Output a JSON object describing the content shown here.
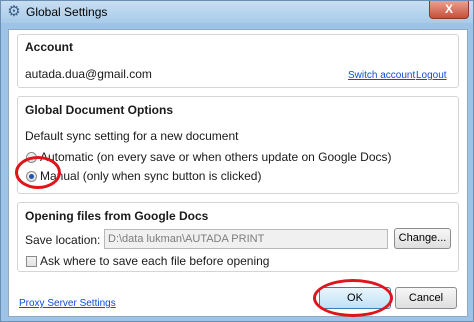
{
  "window": {
    "title": "Global Settings",
    "close_label": "X"
  },
  "account": {
    "heading": "Account",
    "email": "autada.dua@gmail.com",
    "switch_label": "Switch account",
    "logout_label": "Logout"
  },
  "doc_options": {
    "heading": "Global Document Options",
    "description": "Default sync setting for a new document",
    "automatic_label": "Automatic (on every save or when others update on Google Docs)",
    "manual_label": "Manual (only when sync button is clicked)",
    "selected": "manual"
  },
  "opening": {
    "heading": "Opening files from Google Docs",
    "save_location_label": "Save location:",
    "save_location_value": "D:\\data lukman\\AUTADA PRINT",
    "change_label": "Change...",
    "ask_label": "Ask where to save each file before opening",
    "ask_checked": false
  },
  "footer": {
    "proxy_label": "Proxy Server Settings",
    "ok_label": "OK",
    "cancel_label": "Cancel"
  },
  "colors": {
    "annotation": "#e0141b",
    "link": "#0b4dd6"
  },
  "icons": {
    "app": "gear-icon",
    "close": "close-icon"
  }
}
